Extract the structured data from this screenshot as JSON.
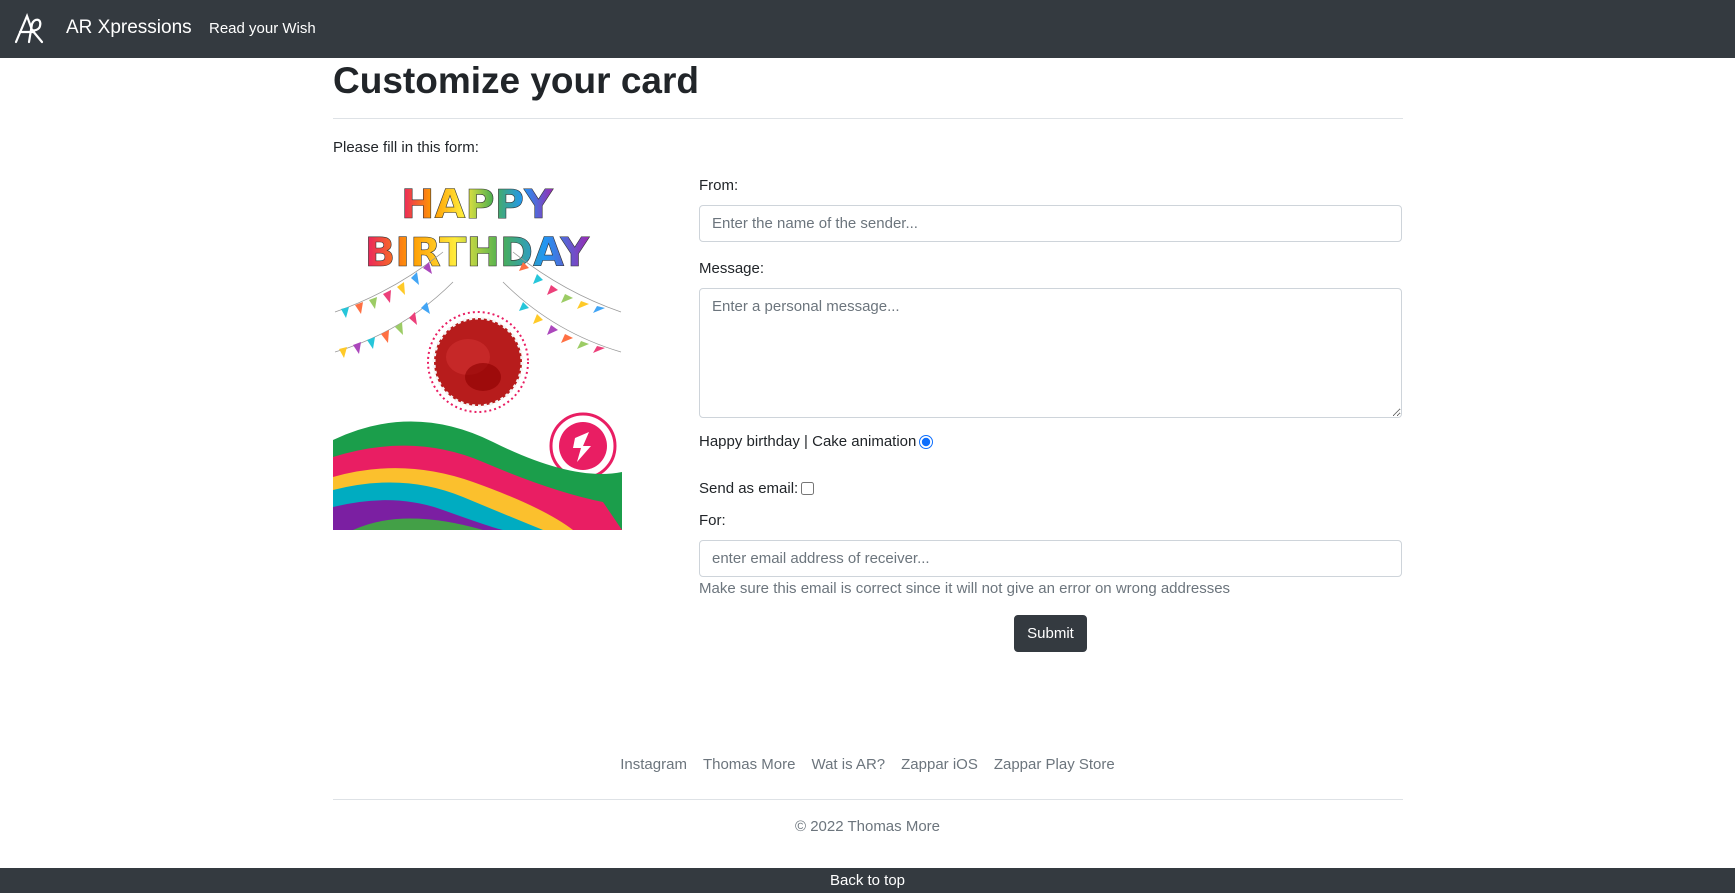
{
  "navbar": {
    "brand": "AR Xpressions",
    "logo_icon": "ar-logo-icon",
    "links": [
      "Read your Wish"
    ]
  },
  "page": {
    "title": "Customize your card",
    "intro": "Please fill in this form:"
  },
  "card": {
    "image_text_line1": "HAPPY",
    "image_text_line2": "BIRTHDAY"
  },
  "form": {
    "from_label": "From:",
    "from_placeholder": "Enter the name of the sender...",
    "message_label": "Message:",
    "message_placeholder": "Enter a personal message...",
    "option_label": "Happy birthday | Cake animation",
    "option_selected": true,
    "send_email_label": "Send as email:",
    "send_email_checked": false,
    "for_label": "For:",
    "for_placeholder": "enter email address of receiver...",
    "help_text": "Make sure this email is correct since it will not give an error on wrong addresses",
    "submit_label": "Submit"
  },
  "footer": {
    "links": [
      "Instagram",
      "Thomas More",
      "Wat is AR?",
      "Zappar iOS",
      "Zappar Play Store"
    ],
    "copyright": "© 2022 Thomas More",
    "back_to_top": "Back to top"
  },
  "colors": {
    "navbar": "#343a40",
    "accent": "#0d6efd",
    "muted": "#6c757d"
  }
}
